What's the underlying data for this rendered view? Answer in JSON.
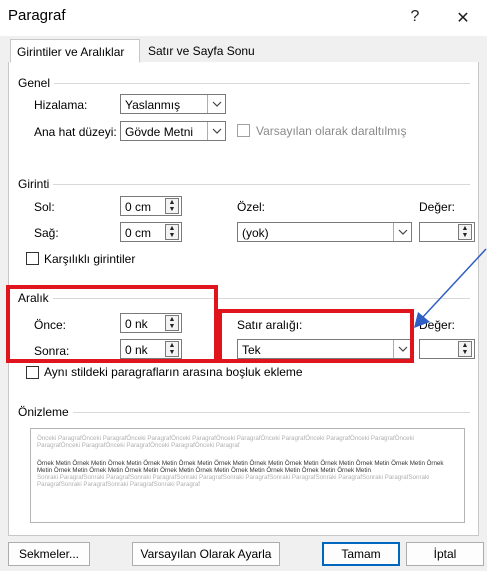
{
  "window": {
    "title": "Paragraf",
    "help": "?",
    "close": "✕"
  },
  "tabs": [
    {
      "label": "Girintiler ve Aralıklar",
      "active": true
    },
    {
      "label": "Satır ve Sayfa Sonu",
      "active": false
    }
  ],
  "genel": {
    "group": "Genel",
    "hizalama_label": "Hizalama:",
    "hizalama_value": "Yaslanmış",
    "ana_hat_label": "Ana hat düzeyi:",
    "ana_hat_value": "Gövde Metni",
    "daraltilmis_label": "Varsayılan olarak daraltılmış",
    "daraltilmis_checked": false
  },
  "girinti": {
    "group": "Girinti",
    "sol_label": "Sol:",
    "sol_value": "0 cm",
    "sag_label": "Sağ:",
    "sag_value": "0 cm",
    "ozel_label": "Özel:",
    "ozel_value": "(yok)",
    "deger_label": "Değer:",
    "deger_value": "",
    "karsilikli_label": "Karşılıklı girintiler",
    "karsilikli_checked": false
  },
  "aralik": {
    "group": "Aralık",
    "once_label": "Önce:",
    "once_value": "0 nk",
    "sonra_label": "Sonra:",
    "sonra_value": "0 nk",
    "satir_label": "Satır aralığı:",
    "satir_value": "Tek",
    "deger_label": "Değer:",
    "deger_value": "",
    "ayni_stil_label": "Aynı stildeki paragrafların arasına boşluk ekleme",
    "ayni_stil_checked": false
  },
  "onizleme": {
    "group": "Önizleme",
    "prev_text": "Önceki ParagrafÖnceki ParagrafÖnceki ParagrafÖnceki ParagrafÖnceki ParagrafÖnceki ParagrafÖnceki ParagrafÖnceki ParagrafÖnceki ParagrafÖnceki ParagrafÖnceki ParagrafÖnceki ParagrafÖnceki Paragraf",
    "sample_text": "Örnek Metin Örnek Metin Örnek Metin Örnek Metin Örnek Metin Örnek Metin Örnek Metin Örnek Metin Örnek Metin Örnek Metin Örnek Metin Örnek Metin Örnek Metin Örnek Metin Örnek Metin Örnek Metin Örnek Metin Örnek Metin Örnek Metin Örnek Metin Örnek Metin",
    "next_text": "Sonraki ParagrafSonraki ParagrafSonraki ParagrafSonraki ParagrafSonraki ParagrafSonraki ParagrafSonraki ParagrafSonraki ParagrafSonraki ParagrafSonraki ParagrafSonraki ParagrafSonraki Paragraf"
  },
  "buttons": {
    "sekmeler": "Sekmeler...",
    "varsayilan": "Varsayılan Olarak Ayarla",
    "tamam": "Tamam",
    "iptal": "İptal"
  },
  "colors": {
    "highlight": "#e0141d",
    "arrow": "#2f5fc4",
    "default_button_border": "#0067c0"
  },
  "icons": {
    "dropdown": "chevron-down-icon",
    "spinner": "spin-up-down-icon"
  }
}
